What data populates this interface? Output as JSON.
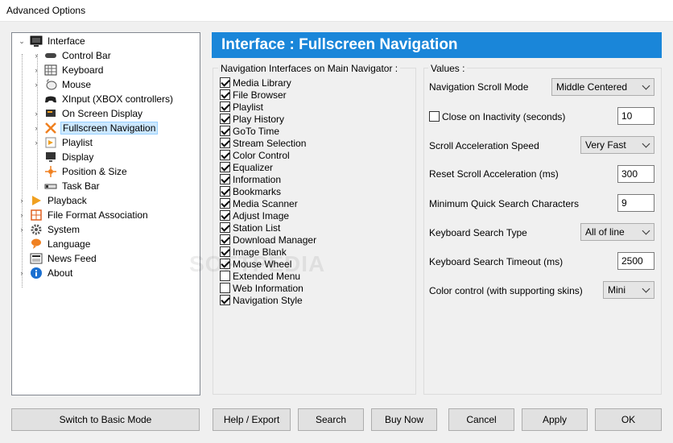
{
  "window": {
    "title": "Advanced Options"
  },
  "tree": {
    "items": [
      {
        "label": "Interface",
        "icon": "monitor-icon",
        "expanded": true
      },
      {
        "label": "Control Bar",
        "icon": "control-bar-icon"
      },
      {
        "label": "Keyboard",
        "icon": "keyboard-icon"
      },
      {
        "label": "Mouse",
        "icon": "mouse-icon"
      },
      {
        "label": "XInput (XBOX controllers)",
        "icon": "gamepad-icon"
      },
      {
        "label": "On Screen Display",
        "icon": "osd-icon"
      },
      {
        "label": "Fullscreen Navigation",
        "icon": "fullscreen-icon",
        "selected": true
      },
      {
        "label": "Playlist",
        "icon": "playlist-icon"
      },
      {
        "label": "Display",
        "icon": "display-icon"
      },
      {
        "label": "Position & Size",
        "icon": "position-icon"
      },
      {
        "label": "Task Bar",
        "icon": "taskbar-icon"
      },
      {
        "label": "Playback",
        "icon": "playback-icon"
      },
      {
        "label": "File Format Association",
        "icon": "file-association-icon"
      },
      {
        "label": "System",
        "icon": "gear-icon"
      },
      {
        "label": "Language",
        "icon": "language-icon"
      },
      {
        "label": "News Feed",
        "icon": "news-icon"
      },
      {
        "label": "About",
        "icon": "info-icon"
      }
    ]
  },
  "header": {
    "title": "Interface : Fullscreen Navigation"
  },
  "nav_interfaces": {
    "title": "Navigation Interfaces on Main Navigator :",
    "items": [
      {
        "label": "Media Library",
        "checked": true
      },
      {
        "label": "File Browser",
        "checked": true
      },
      {
        "label": "Playlist",
        "checked": true
      },
      {
        "label": "Play History",
        "checked": true
      },
      {
        "label": "GoTo Time",
        "checked": true
      },
      {
        "label": "Stream Selection",
        "checked": true
      },
      {
        "label": "Color Control",
        "checked": true
      },
      {
        "label": "Equalizer",
        "checked": true
      },
      {
        "label": "Information",
        "checked": true
      },
      {
        "label": "Bookmarks",
        "checked": true
      },
      {
        "label": "Media Scanner",
        "checked": true
      },
      {
        "label": "Adjust Image",
        "checked": true
      },
      {
        "label": "Station List",
        "checked": true
      },
      {
        "label": "Download Manager",
        "checked": true
      },
      {
        "label": "Image Blank",
        "checked": true
      },
      {
        "label": "Mouse Wheel",
        "checked": true
      },
      {
        "label": "Extended Menu",
        "checked": false
      },
      {
        "label": "Web Information",
        "checked": false
      },
      {
        "label": "Navigation Style",
        "checked": true
      }
    ]
  },
  "values": {
    "title": "Values :",
    "scroll_mode": {
      "label": "Navigation Scroll Mode",
      "value": "Middle Centered"
    },
    "close_inactivity": {
      "label": "Close on Inactivity (seconds)",
      "checked": false,
      "value": "10"
    },
    "scroll_accel_speed": {
      "label": "Scroll Acceleration Speed",
      "value": "Very Fast"
    },
    "reset_scroll_accel": {
      "label": "Reset Scroll Acceleration (ms)",
      "value": "300"
    },
    "min_quick_search": {
      "label": "Minimum Quick Search Characters",
      "value": "9"
    },
    "keyboard_search_type": {
      "label": "Keyboard Search Type",
      "value": "All of line"
    },
    "keyboard_search_timeout": {
      "label": "Keyboard Search Timeout (ms)",
      "value": "2500"
    },
    "color_control": {
      "label": "Color control (with supporting skins)",
      "value": "Mini"
    }
  },
  "buttons": {
    "switch_basic": "Switch to Basic Mode",
    "help_export": "Help / Export",
    "search": "Search",
    "buy_now": "Buy Now",
    "cancel": "Cancel",
    "apply": "Apply",
    "ok": "OK"
  },
  "watermark": "SOFTPEDIA",
  "colors": {
    "banner": "#1a86d9",
    "selection": "#cce8ff"
  }
}
